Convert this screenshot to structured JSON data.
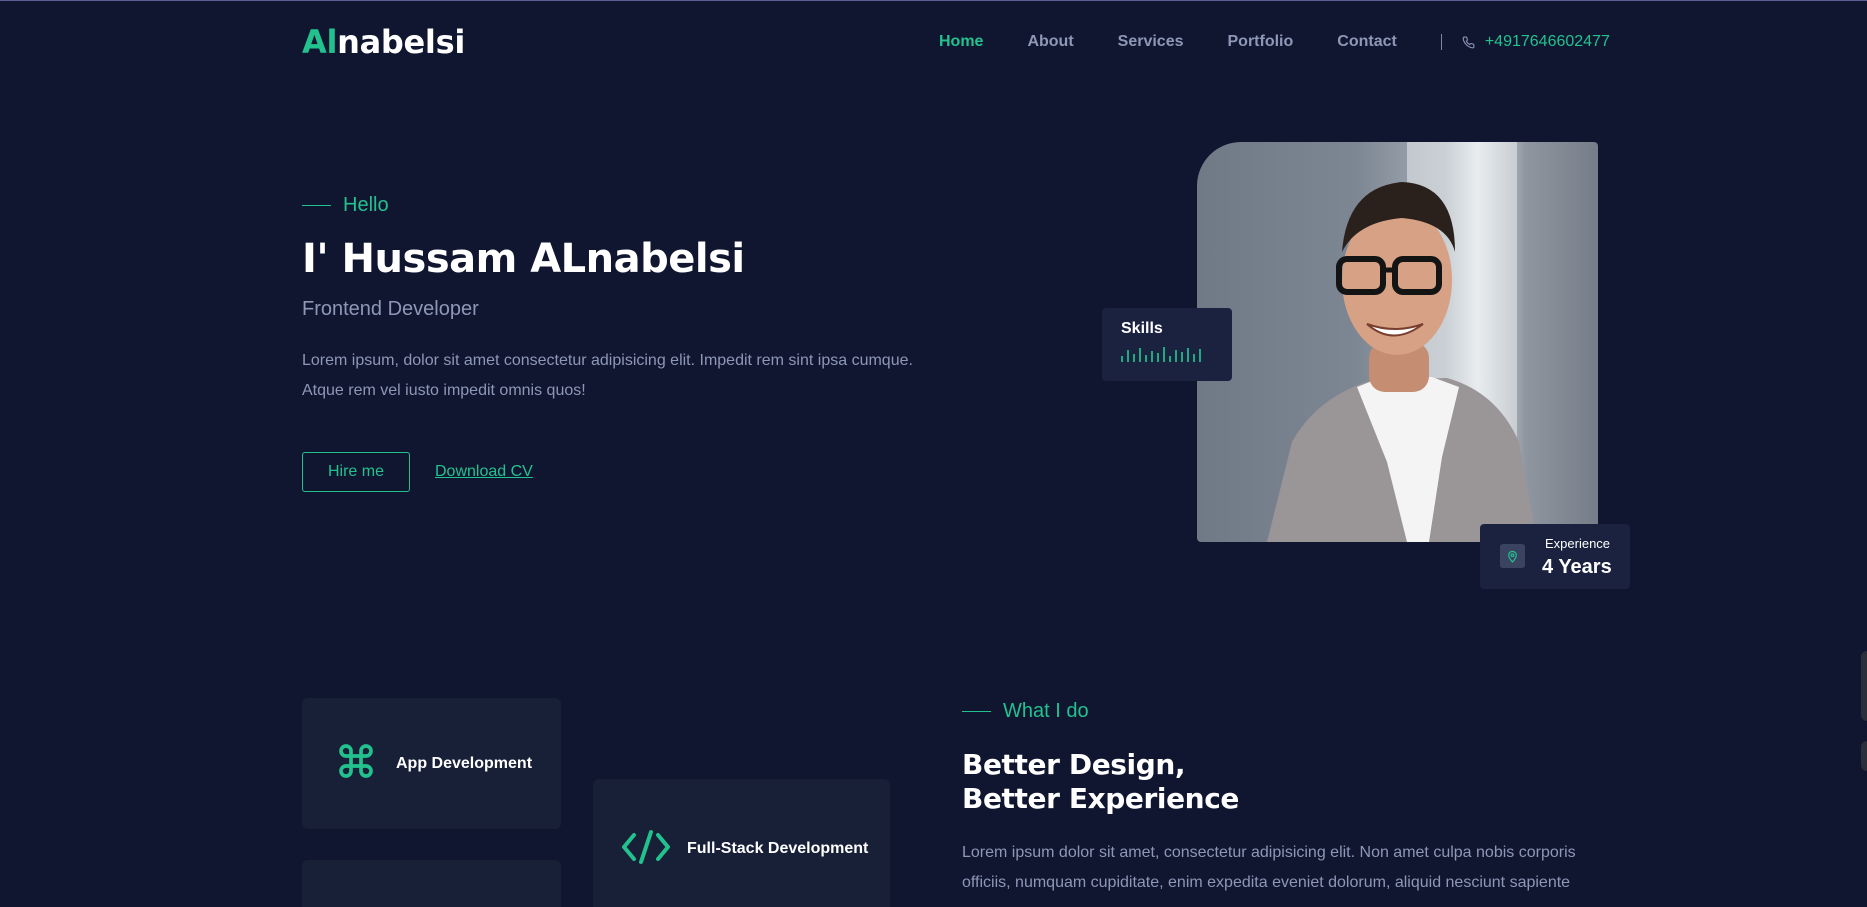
{
  "brand": {
    "logo_accent": "Al",
    "logo_rest": "nabelsi"
  },
  "nav": {
    "items": [
      {
        "label": "Home",
        "active": true
      },
      {
        "label": "About",
        "active": false
      },
      {
        "label": "Services",
        "active": false
      },
      {
        "label": "Portfolio",
        "active": false
      },
      {
        "label": "Contact",
        "active": false
      }
    ],
    "phone": "+4917646602477",
    "phone_icon": "phone-icon"
  },
  "hero": {
    "eyebrow": "Hello",
    "title": "I' Hussam ALnabelsi",
    "role": "Frontend Developer",
    "description": "Lorem ipsum, dolor sit amet consectetur adipisicing elit. Impedit rem sint ipsa cumque. Atque rem vel iusto impedit omnis quos!",
    "hire_button": "Hire me",
    "cv_link": "Download CV"
  },
  "skills_card": {
    "label": "Skills",
    "icon": "audio-bars-icon"
  },
  "experience_card": {
    "caption": "Experience",
    "value": "4 Years",
    "icon": "location-pin-icon"
  },
  "services": {
    "cards": [
      {
        "title": "App Development",
        "icon": "command-icon"
      },
      {
        "title": "Full-Stack Development",
        "icon": "code-icon"
      }
    ],
    "eyebrow": "What I do",
    "title_line1": "Better Design,",
    "title_line2": "Better Experience",
    "description": "Lorem ipsum dolor sit amet, consectetur adipisicing elit. Non amet culpa nobis corporis officiis, numquam cupiditate, enim expedita eveniet dolorum, aliquid nesciunt sapiente"
  },
  "colors": {
    "accent": "#22c28e",
    "background": "#101630",
    "card": "#182038",
    "muted": "#8d97b6"
  }
}
